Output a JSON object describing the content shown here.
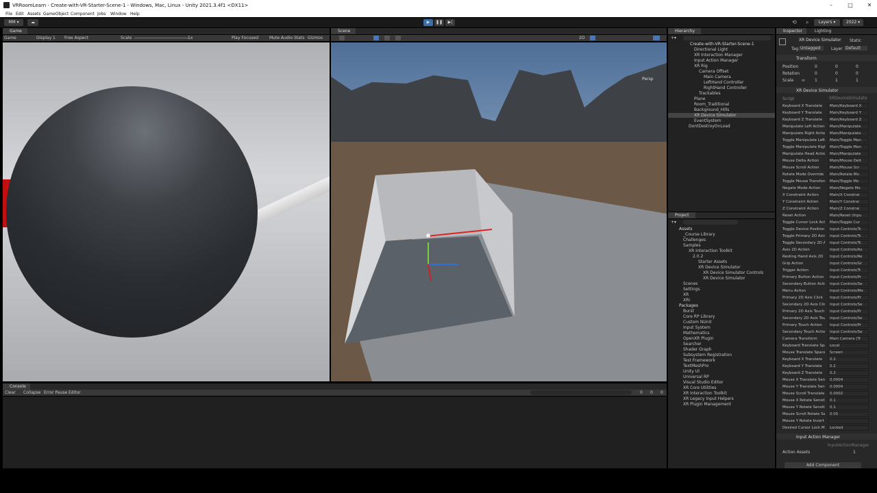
{
  "window": {
    "title": "VRRoomLearn - Create-with-VR-Starter-Scene-1 - Windows, Mac, Linux - Unity 2021.3.4f1 <DX11>"
  },
  "menu": [
    "File",
    "Edit",
    "Assets",
    "GameObject",
    "Component",
    "Jobs",
    "Window",
    "Help"
  ],
  "toolbar": {
    "account": "MM",
    "layers": "Layers",
    "layout": "2022"
  },
  "game": {
    "tab": "Game",
    "view": "Game",
    "display": "Display 1",
    "aspect": "Free Aspect",
    "scale_label": "Scale",
    "scale_value": "1x",
    "play_focused": "Play Focused",
    "mute": "Mute Audio",
    "stats": "Stats",
    "gizmos": "Gizmos"
  },
  "scene": {
    "tab": "Scene",
    "mode_2d": "2D",
    "persp": "Persp"
  },
  "hierarchy": {
    "tab": "Hierarchy",
    "items": [
      "Create-with-VR-Starter-Scene-1",
      "Directional Light",
      "XR Interaction Manager",
      "Input Action Manager",
      "XR Rig",
      "Camera Offset",
      "Main Camera",
      "LeftHand Controller",
      "RightHand Controller",
      "Trackables",
      "Plane",
      "Room_Traditional",
      "Background_Hills",
      "XR Device Simulator",
      "EventSystem",
      "DontDestroyOnLoad"
    ]
  },
  "project": {
    "tab": "Project",
    "items": [
      "Assets",
      "_Course Library",
      "Challenges",
      "Samples",
      "XR Interaction Toolkit",
      "2.0.2",
      "Starter Assets",
      "XR Device Simulator",
      "XR Device Simulator Controls",
      "XR Device Simulator",
      "Scenes",
      "Settings",
      "XR",
      "XRI",
      "Packages",
      "Burst",
      "Core RP Library",
      "Custom NUnit",
      "Input System",
      "Mathematics",
      "OpenXR Plugin",
      "Searcher",
      "Shader Graph",
      "Subsystem Registration",
      "Test Framework",
      "TextMeshPro",
      "Unity UI",
      "Universal RP",
      "Visual Studio Editor",
      "XR Core Utilities",
      "XR Interaction Toolkit",
      "XR Legacy Input Helpers",
      "XR Plugin Management"
    ]
  },
  "inspector": {
    "tab": "Inspector",
    "tab2": "Lighting",
    "object_name": "XR Device Simulator",
    "static": "Static",
    "tag_label": "Tag",
    "tag": "Untagged",
    "layer_label": "Layer",
    "layer": "Default",
    "transform": {
      "title": "Transform",
      "position": "Position",
      "rotation": "Rotation",
      "scale": "Scale",
      "pos": [
        "0",
        "0",
        "0"
      ],
      "rot": [
        "0",
        "0",
        "0"
      ],
      "scl": [
        "1",
        "1",
        "1"
      ],
      "scale_lock": "∞"
    },
    "component_title": "XR Device Simulator",
    "script_label": "Script",
    "script_value": "XRDeviceSimulator",
    "rows": [
      [
        "Keyboard X Translate",
        "Main/Keyboard X"
      ],
      [
        "Keyboard Y Translate",
        "Main/Keyboard Y"
      ],
      [
        "Keyboard Z Translate",
        "Main/Keyboard Z"
      ],
      [
        "Manipulate Left Action",
        "Main/Manipulate"
      ],
      [
        "Manipulate Right Action",
        "Main/Manipulate"
      ],
      [
        "Toggle Manipulate Left",
        "Main/Toggle Man"
      ],
      [
        "Toggle Manipulate Right",
        "Main/Toggle Man"
      ],
      [
        "Manipulate Head Action",
        "Main/Manipulate"
      ],
      [
        "Mouse Delta Action",
        "Main/Mouse Delt"
      ],
      [
        "Mouse Scroll Action",
        "Main/Mouse Scr"
      ],
      [
        "Rotate Mode Override",
        "Main/Rotate Mo"
      ],
      [
        "Toggle Mouse Transform",
        "Main/Toggle Mo"
      ],
      [
        "Negate Mode Action",
        "Main/Negate Mo"
      ],
      [
        "X Constraint Action",
        "Main/X Constrai"
      ],
      [
        "Y Constraint Action",
        "Main/Y Constrai"
      ],
      [
        "Z Constraint Action",
        "Main/Z Constrai"
      ],
      [
        "Reset Action",
        "Main/Reset (Inpu"
      ],
      [
        "Toggle Cursor Lock Action",
        "Main/Toggle Cur"
      ],
      [
        "Toggle Device Position",
        "Input Controls/Tc"
      ],
      [
        "Toggle Primary 2D Axis",
        "Input Controls/Tc"
      ],
      [
        "Toggle Secondary 2D Axis",
        "Input Controls/Tc"
      ],
      [
        "Axis 2D Action",
        "Input Controls/Ax"
      ],
      [
        "Resting Hand Axis 2D",
        "Input Controls/Re"
      ],
      [
        "Grip Action",
        "Input Controls/Gr"
      ],
      [
        "Trigger Action",
        "Input Controls/Tr"
      ],
      [
        "Primary Button Action",
        "Input Controls/Pr"
      ],
      [
        "Secondary Button Action",
        "Input Controls/Se"
      ],
      [
        "Menu Action",
        "Input Controls/Me"
      ],
      [
        "Primary 2D Axis Click",
        "Input Controls/Pr"
      ],
      [
        "Secondary 2D Axis Click",
        "Input Controls/Se"
      ],
      [
        "Primary 2D Axis Touch",
        "Input Controls/Pr"
      ],
      [
        "Secondary 2D Axis Touch",
        "Input Controls/Se"
      ],
      [
        "Primary Touch Action",
        "Input Controls/Pr"
      ],
      [
        "Secondary Touch Action",
        "Input Controls/Se"
      ],
      [
        "Camera Transform",
        "Main Camera (Tr"
      ],
      [
        "Keyboard Translate Space",
        "Local"
      ],
      [
        "Mouse Translate Space",
        "Screen"
      ],
      [
        "Keyboard X Translate",
        "0.2"
      ],
      [
        "Keyboard Y Translate",
        "0.2"
      ],
      [
        "Keyboard Z Translate",
        "0.2"
      ],
      [
        "Mouse X Translate Sensitivity",
        "0.0004"
      ],
      [
        "Mouse Y Translate Sensitivity",
        "0.0004"
      ],
      [
        "Mouse Scroll Translate",
        "0.0002"
      ],
      [
        "Mouse X Rotate Sensitivity",
        "0.1"
      ],
      [
        "Mouse Y Rotate Sensitivity",
        "0.1"
      ],
      [
        "Mouse Scroll Rotate Sensitivity",
        "0.05"
      ],
      [
        "Mouse Y Rotate Invert",
        ""
      ],
      [
        "Desired Cursor Lock Mode",
        "Locked"
      ]
    ],
    "input_action_manager": "Input Action Manager",
    "iam_script": "InputActionManager",
    "action_assets": "Action Assets",
    "action_assets_count": "1",
    "add_component": "Add Component"
  },
  "console": {
    "tab": "Console",
    "clear": "Clear",
    "collapse": "Collapse",
    "error_pause": "Error Pause",
    "editor": "Editor",
    "count_a": "0",
    "count_b": "0",
    "count_c": "0"
  }
}
